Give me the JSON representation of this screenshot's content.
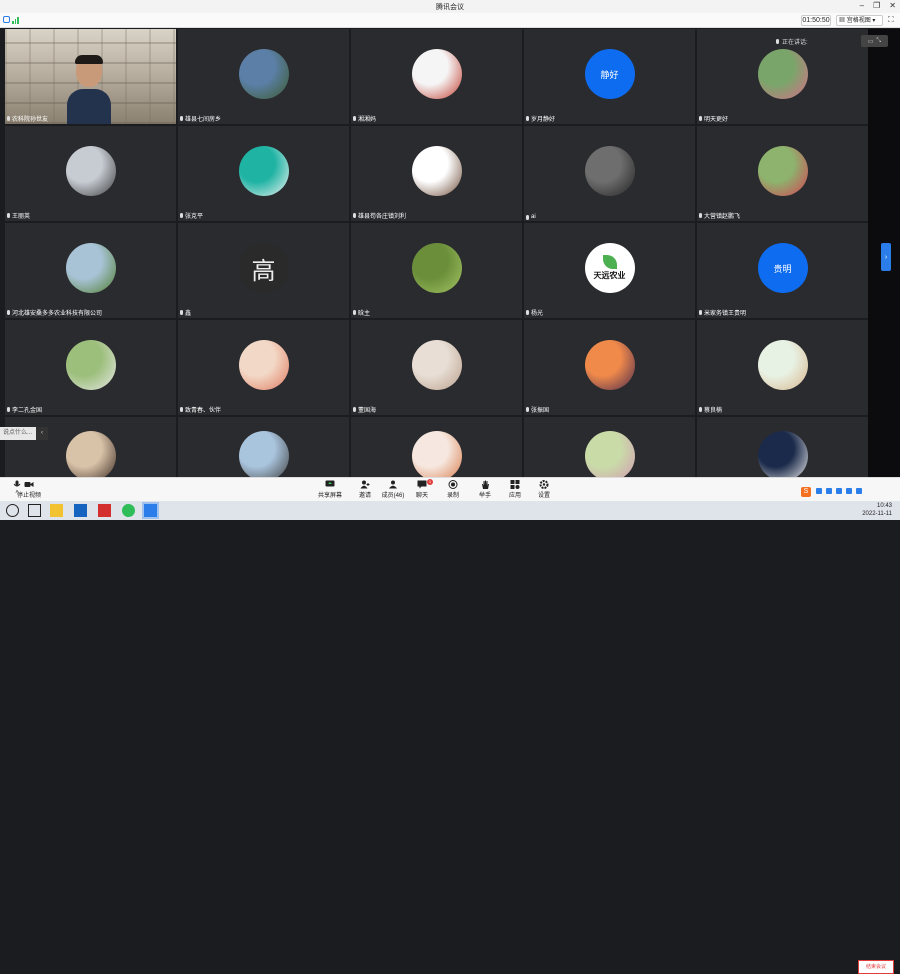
{
  "window": {
    "title": "腾讯会议"
  },
  "topbar": {
    "timer": "01:50:50",
    "view_label": "宫格视图"
  },
  "speaking_label": "正在讲话:",
  "participants": [
    {
      "name": "农科院孙世友",
      "type": "video"
    },
    {
      "name": "雄县七间房乡",
      "type": "photo",
      "colors": [
        "#5b7fa6",
        "#3b5a2c"
      ]
    },
    {
      "name": "湘湘妈",
      "type": "photo",
      "colors": [
        "#f5f5f5",
        "#c0392b"
      ]
    },
    {
      "name": "岁月静好",
      "type": "text",
      "avatar_text": "静好",
      "color": "#0e6cf0"
    },
    {
      "name": "明天更好",
      "type": "photo",
      "colors": [
        "#7aa56a",
        "#d76e8a"
      ]
    },
    {
      "name": "王丽英",
      "type": "photo",
      "colors": [
        "#c7ccd3",
        "#3b3b3b"
      ]
    },
    {
      "name": "张克平",
      "type": "photo",
      "colors": [
        "#1fb3a3",
        "#f4f4f4"
      ]
    },
    {
      "name": "雄县苟各庄镇刘利",
      "type": "photo",
      "colors": [
        "#ffffff",
        "#6b4a36"
      ]
    },
    {
      "name": "ai",
      "type": "photo",
      "colors": [
        "#6e6e6e",
        "#222222"
      ]
    },
    {
      "name": "大营镇赵鹏飞",
      "type": "photo",
      "colors": [
        "#8db36e",
        "#d64053"
      ]
    },
    {
      "name": "河北雄安桑多多农业科技有限公司",
      "type": "photo",
      "colors": [
        "#a8c3d6",
        "#4f7d2e"
      ]
    },
    {
      "name": "鑫",
      "type": "text",
      "avatar_text": "高",
      "color": "#2a2a2a"
    },
    {
      "name": "晗主",
      "type": "photo",
      "colors": [
        "#6b8e3a",
        "#a4c463"
      ]
    },
    {
      "name": "杨光",
      "type": "logo",
      "avatar_text": "天远农业",
      "color": "#ffffff"
    },
    {
      "name": "米家务镇王贵明",
      "type": "text",
      "avatar_text": "贵明",
      "color": "#0e6cf0"
    },
    {
      "name": "李二孔金国",
      "type": "photo",
      "colors": [
        "#9dbf7c",
        "#e8e8e8"
      ]
    },
    {
      "name": "致青春、伙伴",
      "type": "photo",
      "colors": [
        "#f2d8c6",
        "#e07a5f"
      ]
    },
    {
      "name": "董国海",
      "type": "photo",
      "colors": [
        "#e8ded5",
        "#b99f8b"
      ]
    },
    {
      "name": "张振国",
      "type": "photo",
      "colors": [
        "#f08a4b",
        "#4a2a4d"
      ]
    },
    {
      "name": "蔡良楠",
      "type": "photo",
      "colors": [
        "#e8f2e4",
        "#d8b48c"
      ]
    },
    {
      "name": "",
      "type": "photo",
      "colors": [
        "#d8c2a8",
        "#3b2a22"
      ]
    },
    {
      "name": "",
      "type": "photo",
      "colors": [
        "#a9c4dd",
        "#3e3e3e"
      ]
    },
    {
      "name": "",
      "type": "photo",
      "colors": [
        "#f6e8e0",
        "#d87b4a"
      ]
    },
    {
      "name": "",
      "type": "photo",
      "colors": [
        "#c9dca8",
        "#d49ab3"
      ]
    },
    {
      "name": "",
      "type": "photo",
      "colors": [
        "#1b2a4a",
        "#f2f2f2"
      ]
    }
  ],
  "chat": {
    "placeholder": "说点什么..."
  },
  "toolbar": {
    "left": [
      {
        "label": "",
        "icon": "microphone-icon"
      },
      {
        "label": "停止视频",
        "icon": "video-camera-icon"
      }
    ],
    "center": [
      {
        "label": "共享屏幕",
        "icon": "share-screen-icon"
      },
      {
        "label": "邀请",
        "icon": "invite-icon"
      },
      {
        "label": "成员(46)",
        "icon": "members-icon"
      },
      {
        "label": "聊天",
        "icon": "chat-icon",
        "badge": "1"
      },
      {
        "label": "录制",
        "icon": "record-icon"
      },
      {
        "label": "举手",
        "icon": "raise-hand-icon"
      },
      {
        "label": "应用",
        "icon": "apps-icon"
      },
      {
        "label": "设置",
        "icon": "settings-icon"
      }
    ],
    "end_button": "结束会议"
  },
  "taskbar": {
    "time": "10:43",
    "date": "2022-11-11"
  }
}
